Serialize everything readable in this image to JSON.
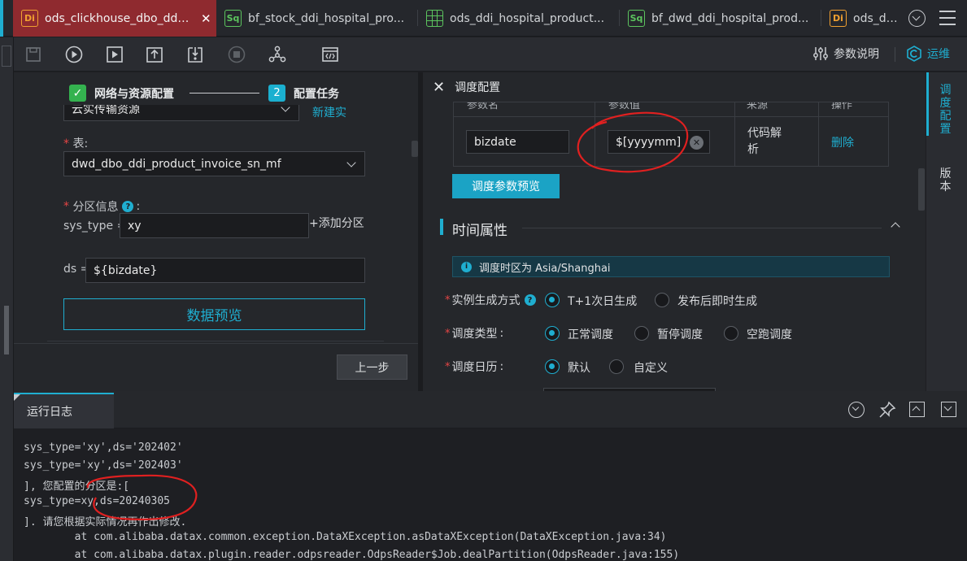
{
  "tabs": [
    {
      "icon": "Di",
      "label": "ods_clickhouse_dbo_ddi_...",
      "active": true
    },
    {
      "icon": "Sq",
      "label": "bf_stock_ddi_hospital_pro..."
    },
    {
      "icon": "grid",
      "label": "ods_ddi_hospital_product..."
    },
    {
      "icon": "Sq",
      "label": "bf_dwd_ddi_hospital_prod..."
    },
    {
      "icon": "Di",
      "label": "ods_ddi_h"
    }
  ],
  "toolbar": {
    "params_label": "参数说明",
    "ops_label": "运维"
  },
  "steps": {
    "step1_label": "网络与资源配置",
    "step2_number": "2",
    "step2_label": "配置任务"
  },
  "source": {
    "datasource_partial": "云实传输资源",
    "new_datasource": "新建实",
    "table_label": "表:",
    "table_value": "dwd_dbo_ddi_product_invoice_sn_mf",
    "partition_label": "分区信息",
    "partition_rows": [
      {
        "key": "sys_type =",
        "value": "xy"
      },
      {
        "key": "ds =",
        "value": "${bizdate}"
      }
    ],
    "add_partition": "+添加分区",
    "preview_button": "数据预览",
    "prev_step": "上一步"
  },
  "schedule": {
    "title": "调度配置",
    "table_headers": [
      "参数名",
      "参数值",
      "来源",
      "操作"
    ],
    "param_row": {
      "name": "bizdate",
      "value": "$[yyyymm]",
      "source_line1": "代码解",
      "source_line2": "析",
      "action": "删除"
    },
    "preview_params_button": "调度参数预览",
    "section_title": "时间属性",
    "timezone_info": "调度时区为 Asia/Shanghai",
    "instance_label": "实例生成方式",
    "instance_options": [
      "T+1次日生成",
      "发布后即时生成"
    ],
    "type_label": "调度类型",
    "type_options": [
      "正常调度",
      "暂停调度",
      "空跑调度"
    ],
    "calendar_label": "调度日历",
    "calendar_options": [
      "默认",
      "自定义"
    ]
  },
  "side_tabs": {
    "tab1": "调度配置",
    "tab2": "版本"
  },
  "log": {
    "tab_label": "运行日志",
    "lines": [
      "sys_type='xy',ds='202402'",
      "sys_type='xy',ds='202403'",
      "], 您配置的分区是:[",
      "sys_type=xy,ds=20240305",
      "]. 请您根据实际情况再作出修改.",
      "        at com.alibaba.datax.common.exception.DataXException.asDataXException(DataXException.java:34)",
      "        at com.alibaba.datax.plugin.reader.odpsreader.OdpsReader$Job.dealPartition(OdpsReader.java:155)"
    ]
  },
  "colors": {
    "accent": "#1faed0",
    "active_tab": "#8f2a2f",
    "annotation": "#e02020"
  }
}
